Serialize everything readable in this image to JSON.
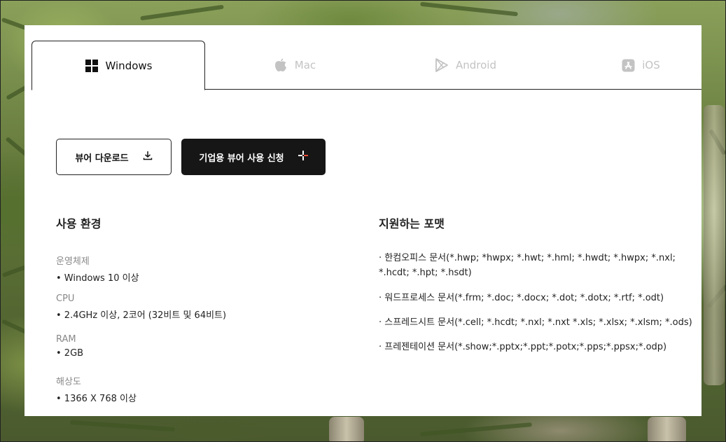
{
  "tabs": [
    {
      "label": "Windows",
      "icon": "windows-icon",
      "active": true
    },
    {
      "label": "Mac",
      "icon": "apple-icon",
      "active": false
    },
    {
      "label": "Android",
      "icon": "play-store-icon",
      "active": false
    },
    {
      "label": "iOS",
      "icon": "app-store-icon",
      "active": false
    }
  ],
  "buttons": {
    "download_label": "뷰어 다운로드",
    "enterprise_label": "기업용 뷰어 사용 신청"
  },
  "requirements": {
    "title": "사용 환경",
    "items": [
      {
        "label": "운영체제",
        "value": "• Windows 10 이상"
      },
      {
        "label": "CPU",
        "value": "• 2.4GHz 이상, 2코어 (32비트 및 64비트)"
      },
      {
        "label": "RAM",
        "value": "• 2GB"
      },
      {
        "label": "해상도",
        "value": "• 1366 X 768 이상"
      }
    ]
  },
  "formats": {
    "title": "지원하는 포맷",
    "items": [
      "· 한컴오피스 문서(*.hwp; *hwpx; *.hwt; *.hml; *.hwdt; *.hwpx; *.nxl; *.hcdt; *.hpt; *.hsdt)",
      "· 워드프로세스 문서(*.frm; *.doc; *.docx; *.dot; *.dotx; *.rtf; *.odt)",
      "· 스프레드시트 문서(*.cell; *.hcdt; *.nxl; *.nxt *.xls; *.xlsx; *.xlsm; *.ods)",
      "· 프레젠테이션 문서(*.show;*.pptx;*.ppt;*.potx;*.pps;*.ppsx;*.odp)"
    ]
  },
  "colors": {
    "text": "#222222",
    "muted": "#888888",
    "inactive_tab": "#c3c3c3",
    "dark_button": "#161616"
  }
}
